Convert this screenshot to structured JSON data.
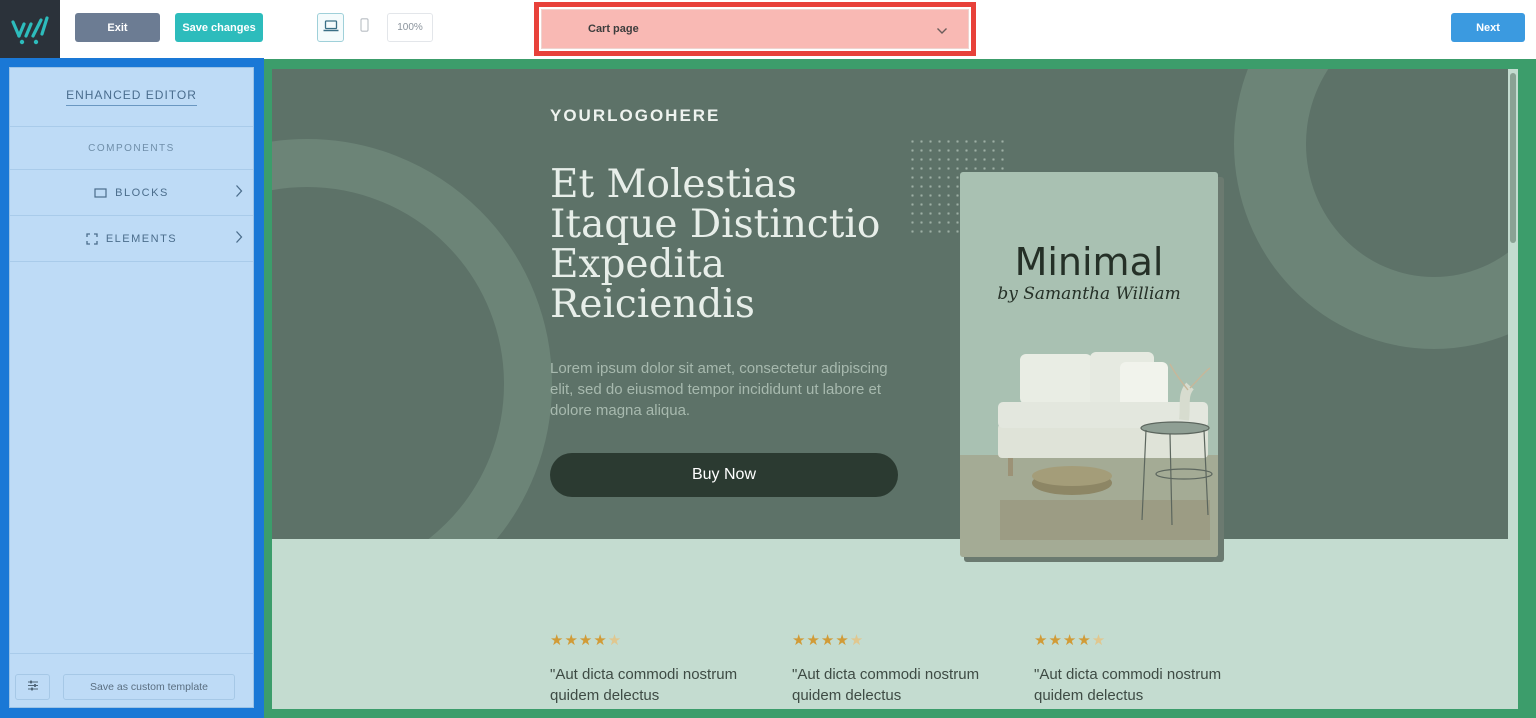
{
  "app": {
    "logo_icon": "cart-logo-icon"
  },
  "toolbar": {
    "exit_label": "Exit",
    "save_label": "Save changes",
    "zoom": "100%",
    "page_select_value": "Cart page",
    "next_label": "Next",
    "colors": {
      "exit": "#6c7c93",
      "save": "#2dbcbc",
      "next": "#3b9ae0",
      "highlight": "#e8413a"
    }
  },
  "sidebar": {
    "title": "ENHANCED EDITOR",
    "section": "COMPONENTS",
    "items": [
      {
        "label": "BLOCKS",
        "icon": "rectangle-icon"
      },
      {
        "label": "ELEMENTS",
        "icon": "expand-icon"
      }
    ],
    "template_label": "Save as custom template",
    "settings_icon": "sliders-icon"
  },
  "canvas": {
    "brand": "YOURLOGOHERE",
    "headline": [
      "Et Molestias",
      "Itaque Distinctio",
      "Expedita",
      "Reiciendis"
    ],
    "lead": "Lorem ipsum dolor sit amet, consectetur adipiscing elit, sed do eiusmod tempor incididunt ut labore et dolore magna aliqua.",
    "cta": "Buy Now",
    "book": {
      "title": "Minimal",
      "author": "by Samantha William"
    },
    "reviews": [
      {
        "stars": "★★★★",
        "half": "★",
        "quote": "\"Aut dicta commodi nostrum quidem delectus"
      },
      {
        "stars": "★★★★",
        "half": "★",
        "quote": "\"Aut dicta commodi nostrum quidem delectus"
      },
      {
        "stars": "★★★★",
        "half": "★",
        "quote": "\"Aut dicta commodi nostrum quidem delectus"
      }
    ]
  }
}
